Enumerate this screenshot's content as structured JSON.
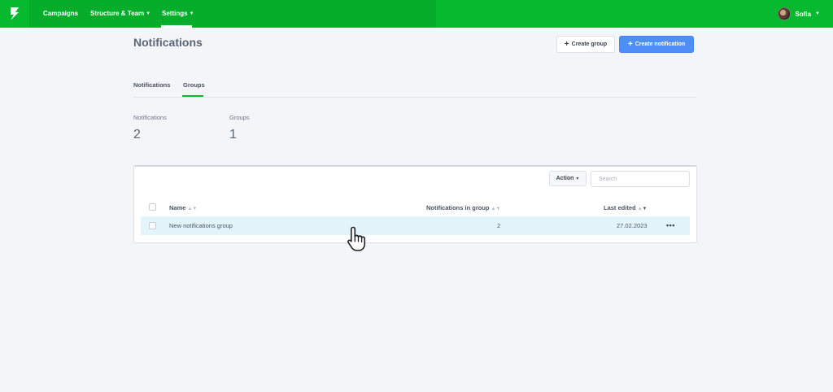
{
  "nav": {
    "items": [
      {
        "label": "Campaigns",
        "has_dropdown": false
      },
      {
        "label": "Structure & Team",
        "has_dropdown": true
      },
      {
        "label": "Settings",
        "has_dropdown": true,
        "active": true
      }
    ],
    "user_name": "Sofia",
    "brand_color": "#07b92f"
  },
  "page": {
    "title": "Notifications",
    "create_group_label": "Create group",
    "create_notification_label": "Create notification"
  },
  "tabs": [
    {
      "label": "Notifications",
      "active": false
    },
    {
      "label": "Groups",
      "active": true
    }
  ],
  "stats": [
    {
      "label": "Notifications",
      "value": "2"
    },
    {
      "label": "Groups",
      "value": "1"
    }
  ],
  "table": {
    "action_label": "Action",
    "search_placeholder": "Search",
    "columns": [
      {
        "label": "Name",
        "sort": "none"
      },
      {
        "label": "Notifications in group",
        "sort": "none"
      },
      {
        "label": "Last edited",
        "sort": "desc"
      }
    ],
    "rows": [
      {
        "name": "New notifications group",
        "count": "2",
        "last_edited": "27.02.2023",
        "hovered": true
      }
    ]
  },
  "icons": {
    "logo": "brand-logo-icon",
    "caret": "chevron-down-icon",
    "plus": "plus-icon",
    "more": "more-horizontal-icon",
    "cursor": "hand-pointer-cursor-icon"
  }
}
